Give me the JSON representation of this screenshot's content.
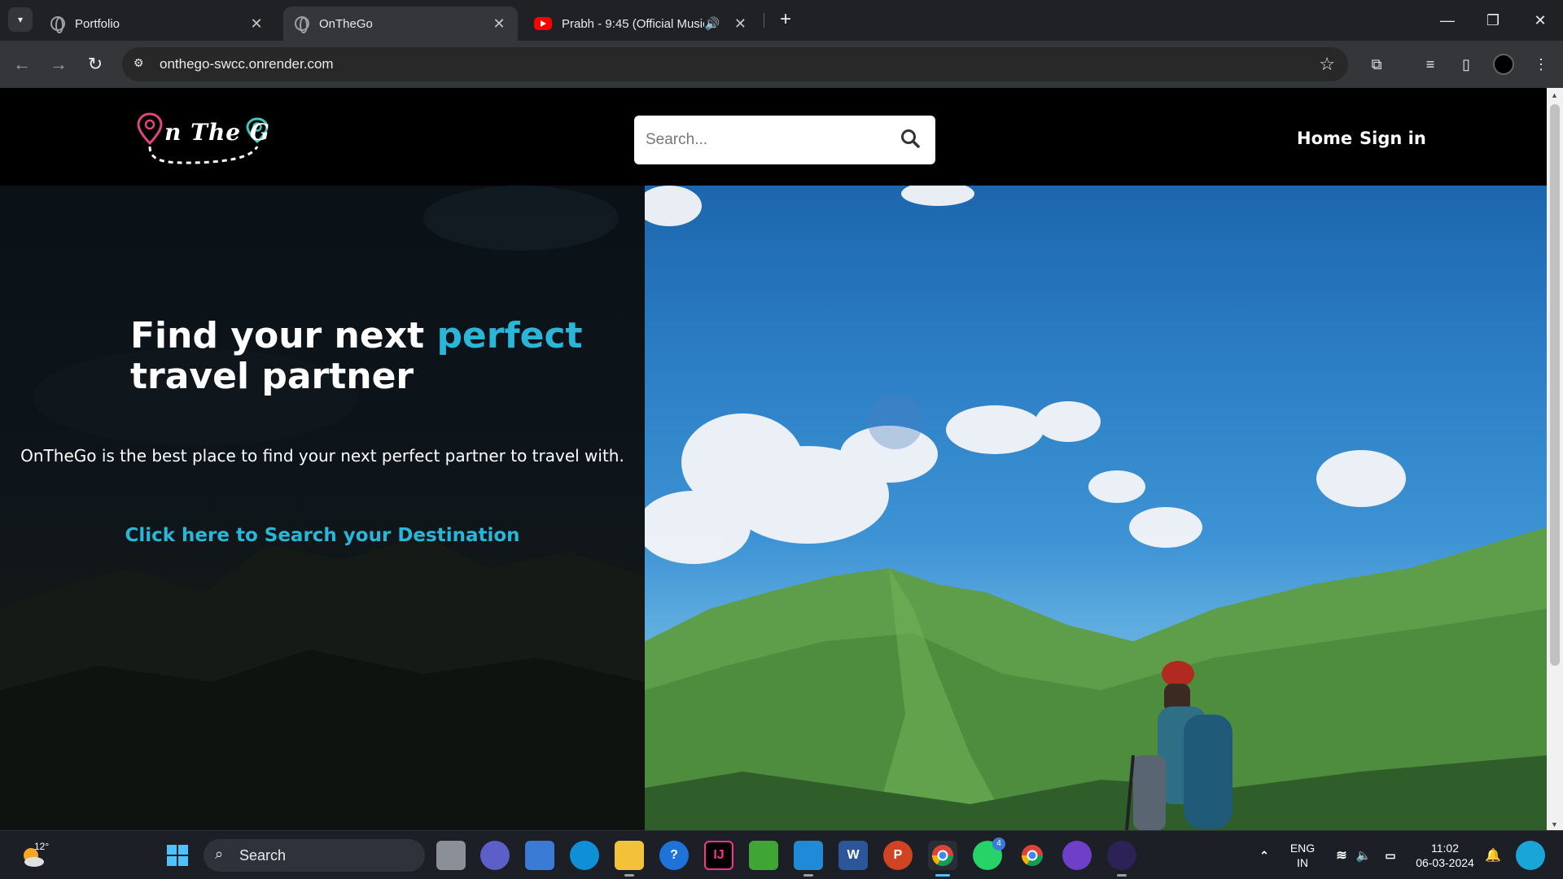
{
  "browser": {
    "tabs": [
      {
        "title": "Portfolio"
      },
      {
        "title": "OnTheGo"
      },
      {
        "title": "Prabh - 9:45 (Official Music"
      }
    ],
    "url": "onthego-swcc.onrender.com"
  },
  "site": {
    "logo_text": "n The G",
    "search": {
      "placeholder": "Search..."
    },
    "nav": {
      "home": "Home",
      "signin": "Sign in"
    },
    "hero": {
      "headline_start": "Find your next ",
      "headline_accent": "perfect",
      "headline_end": "travel partner",
      "subline": "OnTheGo is the best place to find your next perfect partner to travel with.",
      "cta": "Click here to Search your Destination"
    },
    "colors": {
      "accent": "#29b6d8",
      "header_bg": "#000000"
    }
  },
  "taskbar": {
    "weather_temp": "12°",
    "search_label": "Search",
    "whatsapp_badge": "4",
    "language": "ENG",
    "region": "IN",
    "time": "11:02",
    "date": "06-03-2024"
  }
}
